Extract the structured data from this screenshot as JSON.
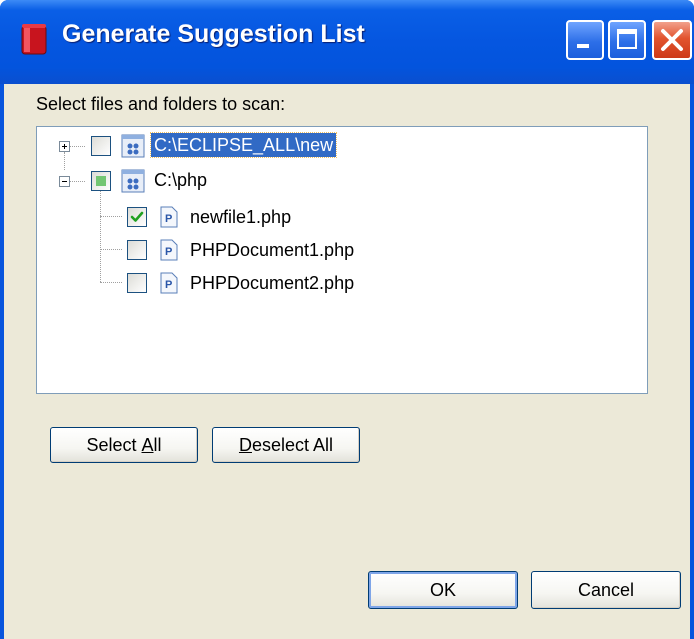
{
  "window": {
    "title": "Generate Suggestion List",
    "controls": [
      "minimize-icon",
      "maximize-icon",
      "close-icon"
    ]
  },
  "dialog": {
    "instruction": "Select files and folders to scan:",
    "tree": [
      {
        "label": "C:\\ECLIPSE_ALL\\new",
        "type": "project-folder",
        "expanded": false,
        "checked": "unchecked",
        "selected": true
      },
      {
        "label": "C:\\php",
        "type": "project-folder",
        "expanded": true,
        "checked": "partial",
        "selected": false,
        "children": [
          {
            "label": "newfile1.php",
            "type": "php-file",
            "checked": "checked"
          },
          {
            "label": "PHPDocument1.php",
            "type": "php-file",
            "checked": "unchecked"
          },
          {
            "label": "PHPDocument2.php",
            "type": "php-file",
            "checked": "unchecked"
          }
        ]
      }
    ],
    "buttons": {
      "select_all_pre": "Select ",
      "select_all_mnemonic": "A",
      "select_all_post": "ll",
      "deselect_all_mnemonic": "D",
      "deselect_all_post": "eselect All",
      "ok": "OK",
      "cancel": "Cancel"
    }
  },
  "colors": {
    "titlebar": "#0554dd",
    "client": "#ece9d8",
    "selection": "#316ac5",
    "check": "#21a121",
    "partial": "#73c673"
  }
}
